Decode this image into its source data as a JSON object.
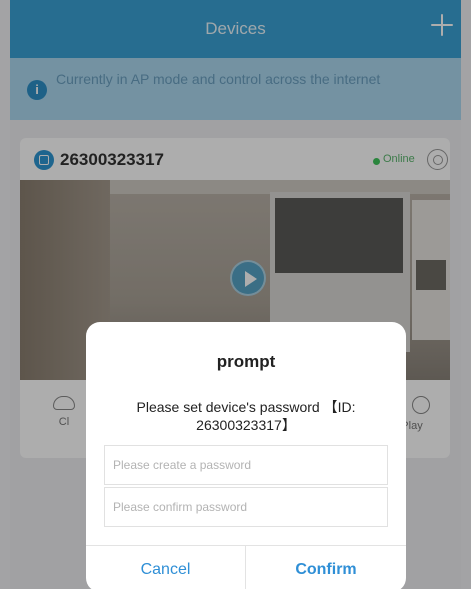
{
  "header": {
    "title": "Devices",
    "add_icon": "plus-icon"
  },
  "notice": {
    "icon": "info-icon",
    "text": "Currently in AP mode and control across the internet"
  },
  "device": {
    "icon": "camera-device-icon",
    "id": "26300323317",
    "status": "Online",
    "status_color": "#3ec45b",
    "settings_icon": "gear-icon",
    "play_icon": "play-icon",
    "actions": {
      "left_label": "Cl",
      "right_label": "Play"
    }
  },
  "dialog": {
    "title": "prompt",
    "message": "Please set device's password 【ID: 26300323317】",
    "password_placeholder": "Please create a password",
    "confirm_placeholder": "Please confirm password",
    "cancel_label": "Cancel",
    "confirm_label": "Confirm",
    "button_color": "#2f8fd6"
  },
  "colors": {
    "header_bg": "#3aa1d4",
    "notice_bg": "#abd7ef"
  }
}
